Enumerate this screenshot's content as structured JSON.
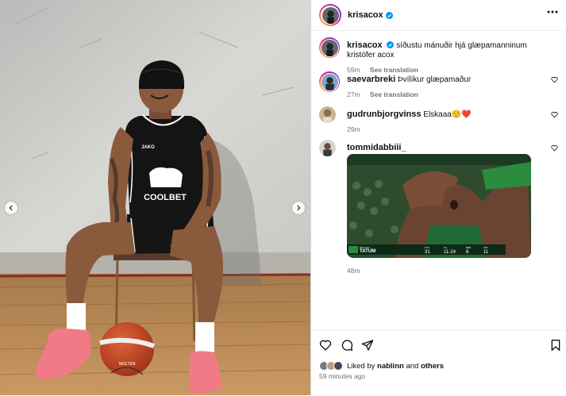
{
  "post": {
    "username": "krisacox",
    "caption": "síðustu mánuðir hjá glæpamanninum kristófer acox",
    "caption_time": "59m",
    "see_translation": "See translation",
    "jersey_brand": "COOLBET",
    "jersey_maker": "JAKO",
    "ball_brand": "MOLTEN"
  },
  "comments": [
    {
      "username": "saevarbreki",
      "text": "Þvílíkur glæpamaður",
      "time": "27m",
      "see_translation": "See translation"
    },
    {
      "username": "gudrunbjorgvinss",
      "text": "Elskaaa☺️❤️",
      "time": "29m"
    },
    {
      "username": "tommidabbiii_",
      "text": "",
      "time": "48m",
      "gif": {
        "player": "TATUM",
        "team": "BOSTON",
        "stats": [
          {
            "label": "PTS",
            "value": "31"
          },
          {
            "label": "FG",
            "value": "11-24"
          },
          {
            "label": "REB",
            "value": "8"
          },
          {
            "label": "AST",
            "value": "11"
          }
        ]
      }
    }
  ],
  "footer": {
    "liked_prefix": "Liked by",
    "liked_user": "nablinn",
    "liked_and": "and",
    "liked_others": "others",
    "posted": "59 minutes ago"
  },
  "icons": {
    "more": "more-horizontal-icon",
    "heart": "heart-icon",
    "comment": "comment-icon",
    "share": "share-icon",
    "save": "bookmark-icon",
    "verified": "verified-badge-icon",
    "prev": "chevron-left-icon",
    "next": "chevron-right-icon"
  },
  "colors": {
    "verified": "#0095f6",
    "heart_red": "#e0245e",
    "shoe_pink": "#f07a86",
    "jersey": "#141414",
    "court_wood": "#b98a55"
  }
}
